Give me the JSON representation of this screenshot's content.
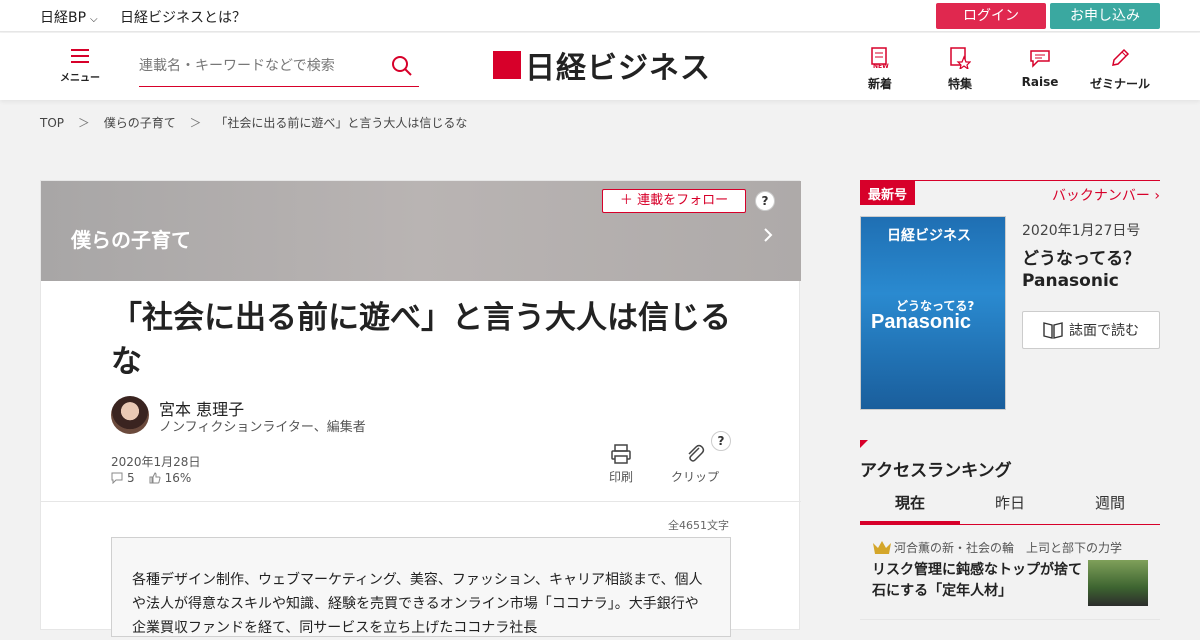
{
  "topbar": {
    "bp_label": "日経BP",
    "about_label": "日経ビジネスとは？",
    "login_label": "ログイン",
    "apply_label": "お申し込み"
  },
  "header": {
    "menu_label": "メニュー",
    "search_placeholder": "連載名・キーワードなどで検索",
    "logo_text": "日経ビジネス",
    "nav": [
      {
        "label": "新着",
        "icon": "new-icon"
      },
      {
        "label": "特集",
        "icon": "feature-icon"
      },
      {
        "label": "Raise",
        "icon": "raise-icon"
      },
      {
        "label": "ゼミナール",
        "icon": "pencil-icon"
      }
    ]
  },
  "breadcrumb": [
    "TOP",
    "僕らの子育て",
    "「社会に出る前に遊べ」と言う大人は信じるな"
  ],
  "article": {
    "series_title": "僕らの子育て",
    "follow_label": "連載をフォロー",
    "headline": "「社会に出る前に遊べ」と言う大人は信じるな",
    "author_name": "宮本 恵理子",
    "author_role": "ノンフィクションライター、編集者",
    "date": "2020年1月28日",
    "comments": "5",
    "likes": "16%",
    "print_label": "印刷",
    "clip_label": "クリップ",
    "char_count": "全4651文字",
    "lead": "各種デザイン制作、ウェブマーケティング、美容、ファッション、キャリア相談まで、個人や法人が得意なスキルや知識、経験を売買できるオンライン市場「ココナラ」。大手銀行や企業買収ファンドを経て、同サービスを立ち上げたココナラ社長"
  },
  "sidebar": {
    "latest_tag": "最新号",
    "backnumber_label": "バックナンバー",
    "cover_logo": "日経ビジネス",
    "cover_question": "どうなってる?",
    "cover_big": "Panasonic",
    "issue_date": "2020年1月27日号",
    "issue_title_1": "どうなってる？",
    "issue_title_2": "Panasonic",
    "read_label": "誌面で読む",
    "ranking_title": "アクセスランキング",
    "ranking_tabs": [
      "現在",
      "昨日",
      "週間"
    ],
    "ranking_item": {
      "category": "河合薫の新・社会の輪　上司と部下の力学",
      "title": "リスク管理に鈍感なトップが捨て石にする「定年人材」"
    }
  },
  "colors": {
    "accent": "#d7002a",
    "login": "#e0284f",
    "apply": "#3aa8a0"
  }
}
